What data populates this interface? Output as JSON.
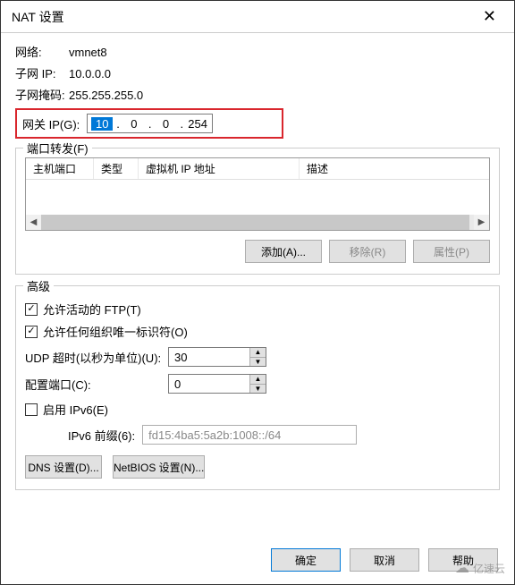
{
  "title": "NAT 设置",
  "info": {
    "network_label": "网络:",
    "network_value": "vmnet8",
    "subnet_ip_label": "子网 IP:",
    "subnet_ip_value": "10.0.0.0",
    "subnet_mask_label": "子网掩码:",
    "subnet_mask_value": "255.255.255.0"
  },
  "gateway": {
    "label": "网关 IP(G):",
    "oct1": "10",
    "oct2": "0",
    "oct3": "0",
    "oct4": "254"
  },
  "port_forward": {
    "legend": "端口转发(F)",
    "cols": {
      "host_port": "主机端口",
      "type": "类型",
      "vm_ip": "虚拟机 IP 地址",
      "desc": "描述"
    },
    "buttons": {
      "add": "添加(A)...",
      "remove": "移除(R)",
      "props": "属性(P)"
    }
  },
  "advanced": {
    "legend": "高级",
    "allow_ftp": "允许活动的 FTP(T)",
    "allow_oui": "允许任何组织唯一标识符(O)",
    "udp_timeout_label": "UDP 超时(以秒为单位)(U):",
    "udp_timeout_value": "30",
    "config_port_label": "配置端口(C):",
    "config_port_value": "0",
    "enable_ipv6": "启用 IPv6(E)",
    "ipv6_prefix_label": "IPv6 前缀(6):",
    "ipv6_prefix_value": "fd15:4ba5:5a2b:1008::/64",
    "dns_btn": "DNS 设置(D)...",
    "netbios_btn": "NetBIOS 设置(N)..."
  },
  "footer": {
    "ok": "确定",
    "cancel": "取消",
    "help": "帮助"
  },
  "watermark": "亿速云"
}
